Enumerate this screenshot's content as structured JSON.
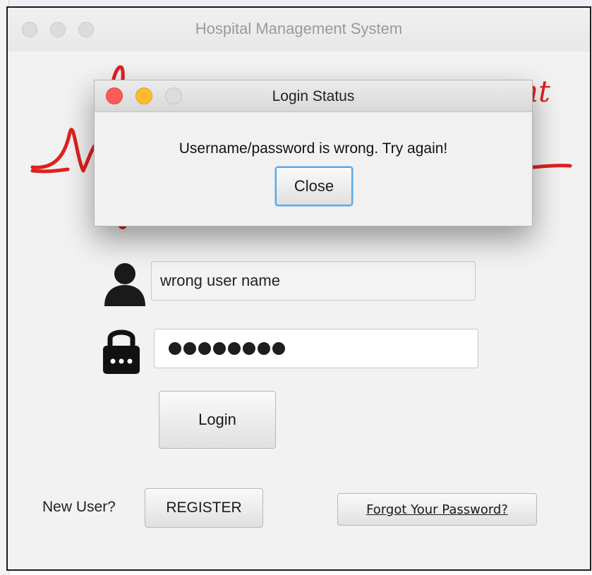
{
  "main_window": {
    "title": "Hospital Management System",
    "username_value": "wrong user name",
    "password_mask": "●●●●●●●●",
    "login_label": "Login",
    "new_user_label": "New User?",
    "register_label": "REGISTER",
    "forgot_password_label": "Forgot Your Password?"
  },
  "dialog": {
    "title": "Login Status",
    "message": "Username/password is wrong. Try again!",
    "close_label": "Close"
  },
  "icons": {
    "user": "user-icon",
    "lock": "lock-icon",
    "logo": "heartbeat-logo"
  },
  "colors": {
    "logo_red": "#e02020",
    "focus_blue": "#58a6e8",
    "traffic_close": "#fc5b57",
    "traffic_minimize": "#fdbc2e"
  }
}
